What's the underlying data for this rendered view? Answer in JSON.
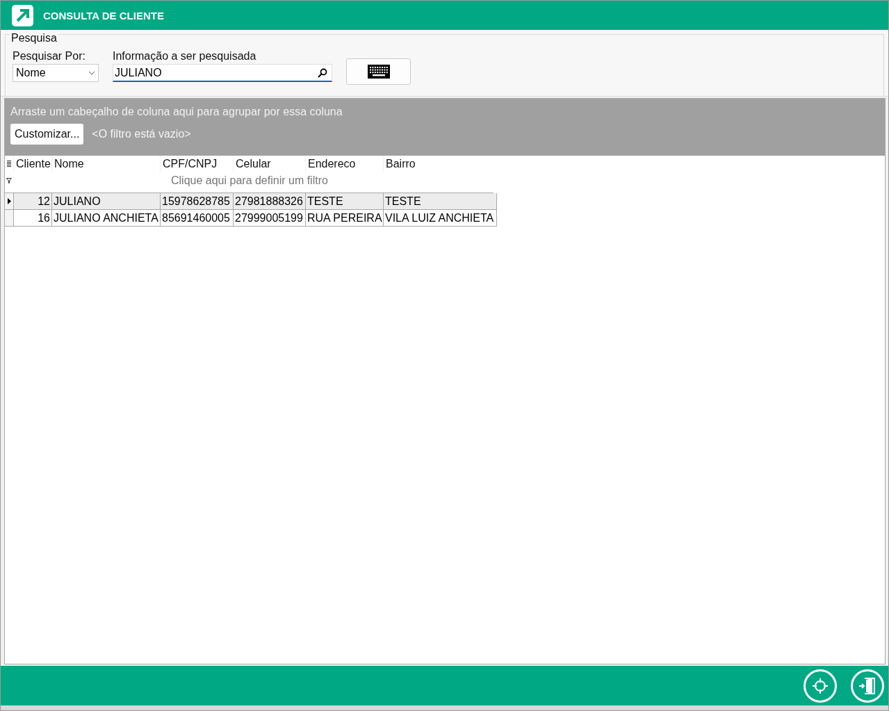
{
  "window": {
    "title": "CONSULTA DE CLIENTE"
  },
  "search": {
    "group_title": "Pesquisa",
    "by_label": "Pesquisar Por:",
    "by_value": "Nome",
    "info_label": "Informação a ser pesquisada",
    "info_value": "JULIANO"
  },
  "group_panel": {
    "hint": "Arraste um cabeçalho de coluna aqui para agrupar por essa coluna",
    "customize_button": "Customizar...",
    "filter_text": "<O filtro está vazio>"
  },
  "table": {
    "columns": [
      "Cliente",
      "Nome",
      "CPF/CNPJ",
      "Celular",
      "Endereco",
      "Bairro"
    ],
    "filter_hint": "Clique aqui para definir um filtro",
    "rows": [
      {
        "selected": true,
        "cells": [
          "12",
          "JULIANO",
          "15978628785",
          "27981888326",
          "TESTE",
          "TESTE"
        ]
      },
      {
        "selected": false,
        "cells": [
          "16",
          "JULIANO ANCHIETA",
          "85691460005",
          "27999005199",
          "RUA PEREIRA",
          "VILA LUIZ ANCHIETA"
        ]
      }
    ]
  }
}
